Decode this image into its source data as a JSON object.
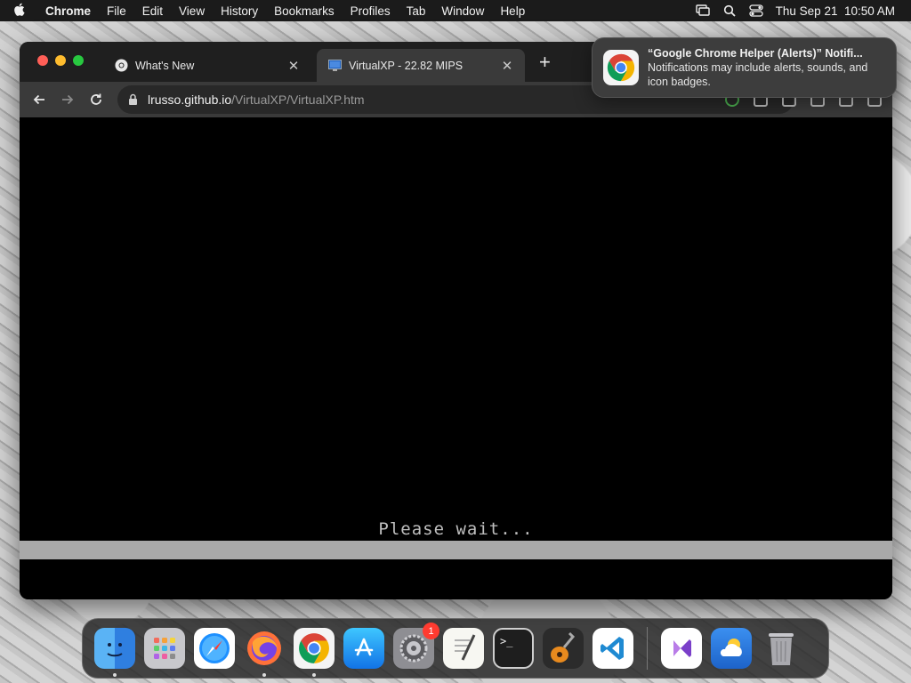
{
  "menubar": {
    "app_name": "Chrome",
    "items": [
      "File",
      "Edit",
      "View",
      "History",
      "Bookmarks",
      "Profiles",
      "Tab",
      "Window",
      "Help"
    ],
    "datetime": "Thu Sep 21  10:50 AM",
    "status_icons": [
      "screen-mirroring-icon",
      "spotlight-search-icon",
      "control-center-icon"
    ]
  },
  "browser": {
    "tabs": [
      {
        "title": "What's New",
        "icon": "chrome-icon",
        "active": false
      },
      {
        "title": "VirtualXP - 22.82 MIPS",
        "icon": "virtualxp-icon",
        "active": true
      }
    ],
    "new_tab_label": "+",
    "address": {
      "host": "lrusso.github.io",
      "path": "/VirtualXP/VirtualXP.htm"
    },
    "page": {
      "status_text": "Please wait...",
      "progress": 1.0,
      "progress_color": "#a9a9a9"
    }
  },
  "notification": {
    "title": "“Google Chrome Helper (Alerts)” Notifi...",
    "body": "Notifications may include alerts, sounds, and icon badges."
  },
  "dock": {
    "apps": [
      {
        "name": "finder-icon",
        "running": true
      },
      {
        "name": "launchpad-icon",
        "running": false
      },
      {
        "name": "safari-icon",
        "running": false
      },
      {
        "name": "firefox-icon",
        "running": true
      },
      {
        "name": "chrome-icon",
        "running": true
      },
      {
        "name": "app-store-icon",
        "running": false
      },
      {
        "name": "system-settings-icon",
        "running": false,
        "badge": "1"
      },
      {
        "name": "textedit-icon",
        "running": false
      },
      {
        "name": "terminal-icon",
        "running": false
      },
      {
        "name": "garageband-icon",
        "running": false
      },
      {
        "name": "vscode-icon",
        "running": false
      },
      {
        "name": "visual-studio-icon",
        "running": false
      },
      {
        "name": "weather-icon",
        "running": false
      },
      {
        "name": "trash-icon",
        "running": false
      }
    ]
  }
}
